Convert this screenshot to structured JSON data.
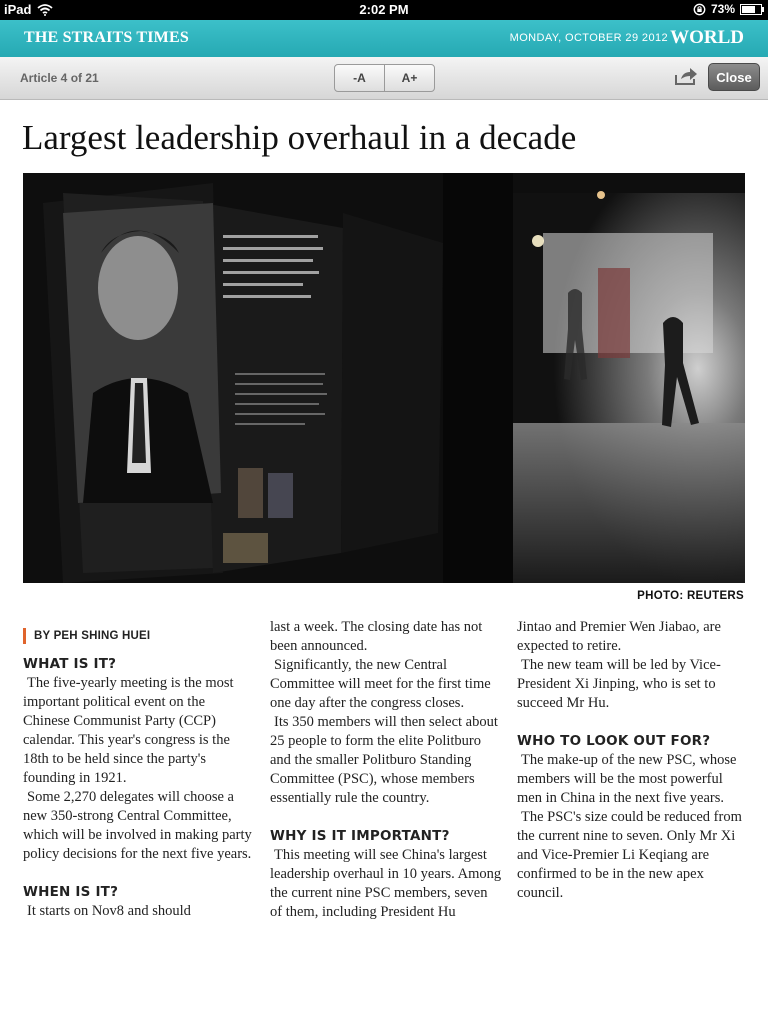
{
  "status_bar": {
    "device": "iPad",
    "time": "2:02 PM",
    "battery": "73%",
    "battery_level": 0.73
  },
  "masthead": {
    "brand": "THE STRAITS TIMES",
    "date": "MONDAY, OCTOBER 29 2012",
    "section": "WORLD"
  },
  "toolbar": {
    "counter": "Article 4 of 21",
    "font_decrease": "-A",
    "font_increase": "A+",
    "close": "Close"
  },
  "article": {
    "headline": "Largest leadership overhaul in a decade",
    "photo_credit": "PHOTO: REUTERS",
    "byline": "BY PEH SHING HUEI",
    "col1": {
      "h1": "WHAT IS IT?",
      "p1": "The five-yearly meeting is the most important political event on the Chinese Communist Party (CCP) calendar. This year's congress is the 18th to be held since the party's founding in 1921.",
      "p2": "Some 2,270 delegates will choose a new 350-strong Central Committee, which will be involved in making party policy decisions for the next five years.",
      "h2": "WHEN IS IT?",
      "p3": "It starts on Nov8 and should"
    },
    "col2": {
      "p1": "last a week. The closing date has not been announced.",
      "p2": "Significantly, the new Central Committee will meet for the first time one day after the congress closes.",
      "p3": "Its 350 members will then select about 25 people to form the elite Politburo and the smaller Politburo Standing Committee (PSC), whose members essentially rule the country.",
      "h1": "WHY IS IT IMPORTANT?",
      "p4": "This meeting will see China's largest leadership overhaul in 10 years. Among the current nine PSC members, seven of them, including President Hu"
    },
    "col3": {
      "p1": "Jintao and Premier Wen Jiabao, are expected to retire.",
      "p2": "The new team will be led by Vice-President Xi Jinping, who is set to succeed Mr Hu.",
      "h1": "WHO TO LOOK OUT FOR?",
      "p3": "The make-up of the new PSC, whose members will be the most powerful men in China in the next five years.",
      "p4": "The PSC's size could be reduced from the current nine to seven. Only Mr Xi and Vice-Premier Li Keqiang are confirmed to be in the new apex council."
    }
  },
  "colors": {
    "masthead": "#2fb5be",
    "byline_accent": "#e0642c"
  },
  "icons": [
    "wifi-icon",
    "lock-rotation-icon",
    "battery-icon",
    "share-icon"
  ]
}
